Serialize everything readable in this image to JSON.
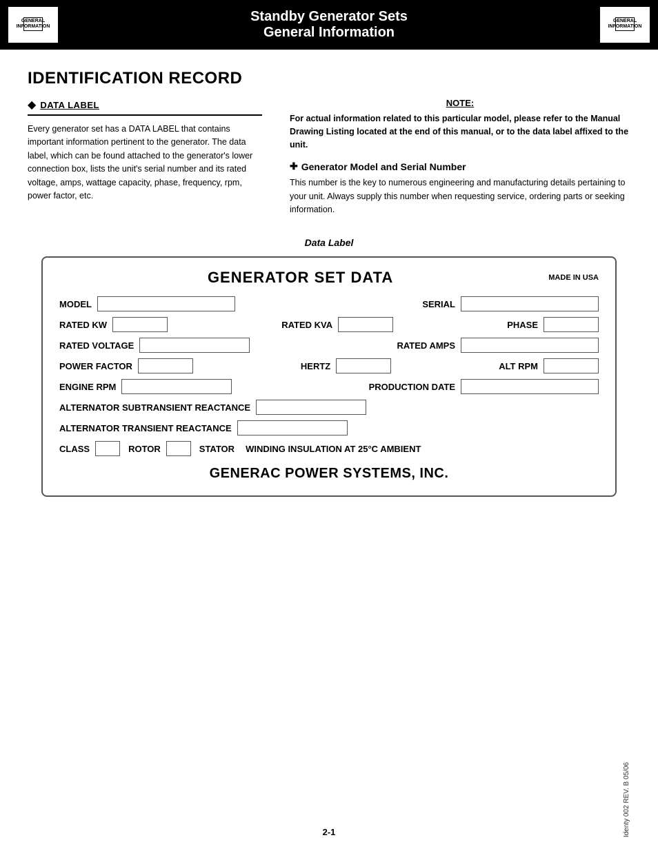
{
  "header": {
    "logo_line1": "GENERAL",
    "logo_line2": "INFORMATION",
    "title_line1": "Standby Generator Sets",
    "title_line2": "General Information"
  },
  "page": {
    "title": "IDENTIFICATION RECORD",
    "section1": {
      "header": "DATA LABEL",
      "body": "Every generator set has a DATA LABEL that contains important information pertinent to the generator. The data label, which can be found attached to the generator's lower connection box, lists the unit's serial number and its rated voltage, amps, wattage capacity, phase, frequency, rpm, power factor, etc."
    },
    "note": {
      "label": "NOTE:",
      "text": "For actual information related to this particular model, please refer to the Manual Drawing Listing located at the end of this manual, or to the data label affixed to the unit."
    },
    "section2": {
      "header": "Generator Model and Serial Number",
      "body": "This number is the key to numerous engineering and manufacturing details pertaining to your unit. Always supply this number when requesting service, ordering parts or seeking information."
    },
    "data_label_caption": "Data Label",
    "card": {
      "title": "GENERATOR SET DATA",
      "made_in_usa": "MADE IN USA",
      "fields": {
        "model_label": "MODEL",
        "serial_label": "SERIAL",
        "rated_kw_label": "RATED KW",
        "rated_kva_label": "RATED KVA",
        "phase_label": "PHASE",
        "rated_voltage_label": "RATED VOLTAGE",
        "rated_amps_label": "RATED AMPS",
        "power_factor_label": "POWER FACTOR",
        "hertz_label": "HERTZ",
        "alt_rpm_label": "ALT RPM",
        "engine_rpm_label": "ENGINE RPM",
        "production_date_label": "PRODUCTION DATE",
        "alternator_sub_label": "ALTERNATOR SUBTRANSIENT REACTANCE",
        "alternator_trans_label": "ALTERNATOR TRANSIENT REACTANCE",
        "class_label": "CLASS",
        "rotor_label": "ROTOR",
        "stator_label": "STATOR",
        "winding_label": "WINDING INSULATION AT 25°C AMBIENT"
      },
      "footer": "GENERAC POWER SYSTEMS, INC."
    }
  },
  "footer": {
    "page_number": "2-1",
    "doc_ref": "Identy 002  REV. B  05/06"
  }
}
